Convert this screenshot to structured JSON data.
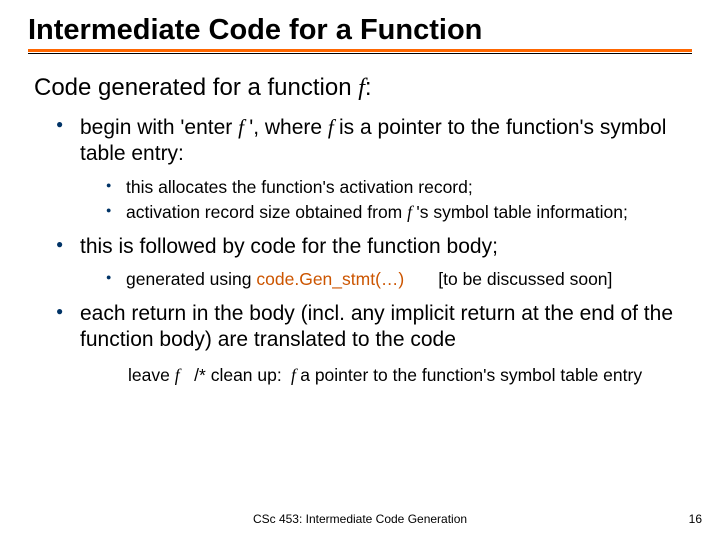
{
  "title": "Intermediate Code for a Function",
  "intro_prefix": "Code generated for a function ",
  "intro_var": "f",
  "intro_suffix": ":",
  "b1_p1": "begin with 'enter ",
  "b1_var": "f ",
  "b1_p2": "', where ",
  "b1_var2": "f ",
  "b1_p3": " is a pointer to the function's symbol table entry:",
  "b1s1": "this allocates the function's activation record;",
  "b1s2_p1": "activation record size obtained from ",
  "b1s2_var": "f ",
  "b1s2_p2": "'s symbol table information;",
  "b2": "this is followed by code for the function body;",
  "b2s1_p1": "generated using ",
  "b2s1_code": "code.Gen_stmt(…)",
  "b2s1_p2": "       [to be discussed soon]",
  "b3": "each return in the body (incl. any implicit return at the end of the function body) are translated to the code",
  "tail_p1": "leave ",
  "tail_var": "f",
  "tail_p2": "   /* clean up: ",
  "tail_var2": " f ",
  "tail_p3": " a pointer to the function's symbol table entry",
  "footer_center": "CSc 453: Intermediate Code Generation",
  "footer_right": "16"
}
